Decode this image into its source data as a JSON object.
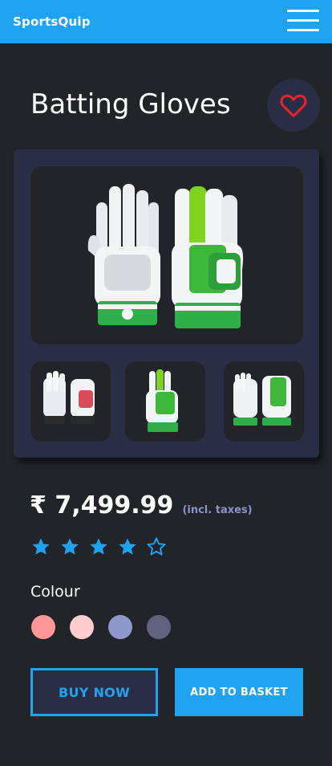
{
  "app": {
    "brand": "SportsQuip"
  },
  "product": {
    "title": "Batting Gloves",
    "price": "₹ 7,499.99",
    "tax_note": "(incl. taxes)",
    "rating": {
      "value": 4,
      "max": 5
    },
    "images": {
      "main": "batting-gloves-green-pair",
      "thumbnails": [
        "batting-gloves-white-pair",
        "batting-glove-green-single",
        "batting-gloves-green-pair-small"
      ]
    }
  },
  "colour": {
    "label": "Colour",
    "swatches": [
      "#ff9797",
      "#ffcdcd",
      "#8e98cc",
      "#5f637f"
    ]
  },
  "actions": {
    "buy_now": "BUY NOW",
    "add_to_basket": "ADD TO BASKET"
  },
  "theme": {
    "accent": "#1fa3f0",
    "background": "#212429",
    "card": "#2a2e45",
    "heart": "#e8232d"
  }
}
